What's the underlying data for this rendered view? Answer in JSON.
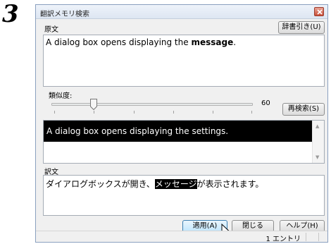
{
  "step": "3",
  "window": {
    "title": "翻訳メモリ検索"
  },
  "source": {
    "label": "原文",
    "dict_button": "辞書引き(U)",
    "text_before": "A dialog box opens displaying the ",
    "text_bold": "message",
    "text_after": "."
  },
  "similarity": {
    "label": "類似度:",
    "value": "60",
    "research_button": "再検索(S)"
  },
  "result": {
    "text": "A dialog box opens displaying the settings."
  },
  "translation": {
    "label": "訳文",
    "text_before": "ダイアログボックスが開き、",
    "text_highlight": "メッセージ",
    "text_after": "が表示されます。"
  },
  "buttons": {
    "apply": "適用(A)",
    "close": "閉じる",
    "help": "ヘルプ(H)"
  },
  "status": {
    "entries": "1 エントリ"
  }
}
